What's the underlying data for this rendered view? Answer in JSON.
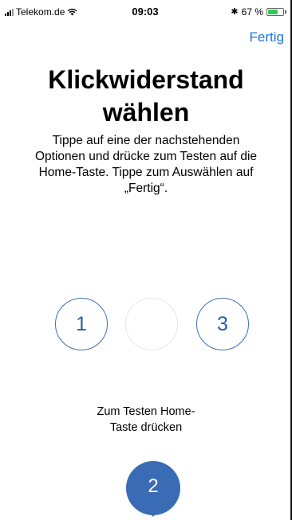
{
  "status_bar": {
    "carrier": "Telekom.de",
    "time": "09:03",
    "battery_percent": "67 %",
    "battery_level": 0.67,
    "battery_color": "#35c759",
    "icons": [
      "signal-icon",
      "wifi-icon",
      "bluetooth-icon",
      "battery-icon"
    ]
  },
  "nav": {
    "done_label": "Fertig",
    "accent_color": "#1a73e8"
  },
  "title": "Klickwiderstand wählen",
  "instructions": "Tippe auf eine der nachstehenden Optionen und drücke zum Testen auf die Home-Taste. Tippe zum Auswählen auf „Fertig“.",
  "options": [
    {
      "label": "1"
    },
    {
      "label": ""
    },
    {
      "label": "3"
    }
  ],
  "test_hint": {
    "line1": "Zum Testen Home-",
    "line2": "Taste drücken"
  },
  "selected": {
    "label": "2",
    "color": "#3a6bb5"
  }
}
